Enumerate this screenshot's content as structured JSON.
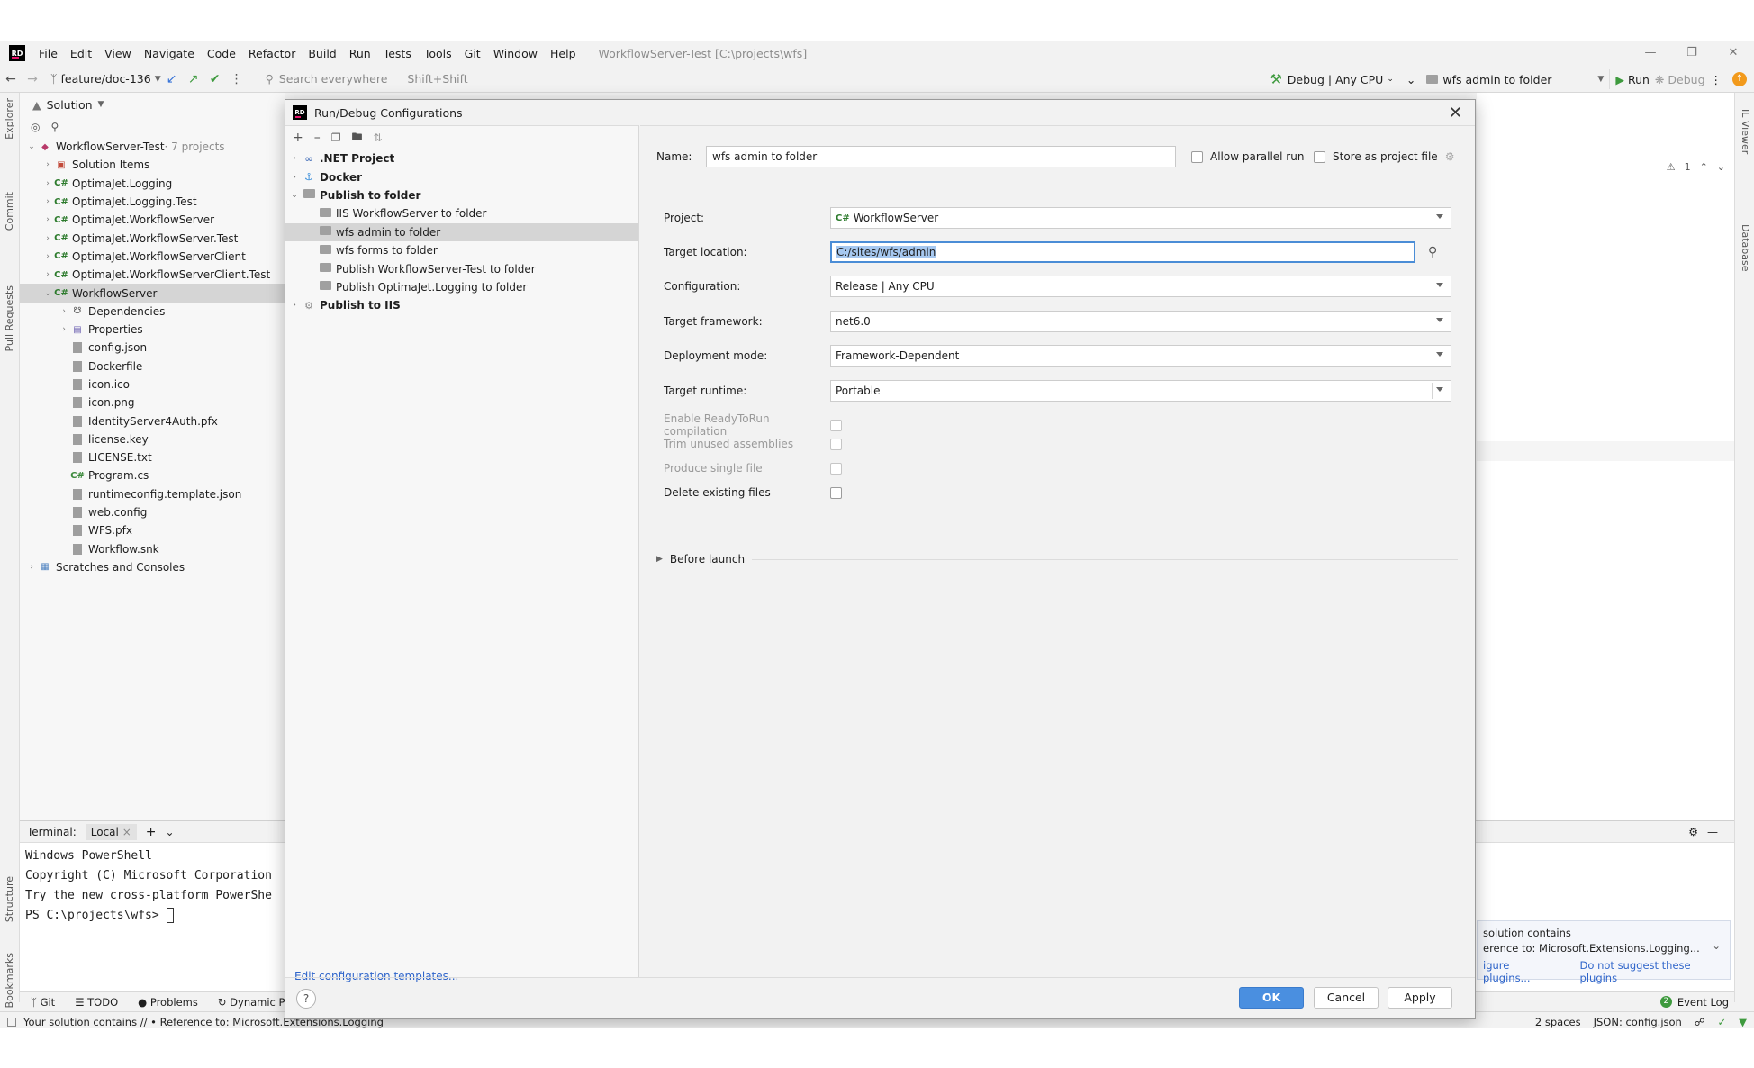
{
  "menubar": {
    "logo": "RD",
    "items": [
      "File",
      "Edit",
      "View",
      "Navigate",
      "Code",
      "Refactor",
      "Build",
      "Run",
      "Tests",
      "Tools",
      "Git",
      "Window",
      "Help"
    ],
    "window_title": "WorkflowServer-Test [C:\\projects\\wfs]"
  },
  "toolbar": {
    "branch": "feature/doc-136",
    "search_placeholder": "Search everywhere",
    "search_shortcut": "Shift+Shift",
    "build_config": "Debug | Any CPU",
    "run_config": "wfs admin to folder",
    "run_label": "Run",
    "debug_label": "Debug"
  },
  "left_stripe": {
    "explorer": "Explorer",
    "commit": "Commit",
    "pull_requests": "Pull Requests",
    "structure": "Structure",
    "bookmarks": "Bookmarks"
  },
  "right_stripe": {
    "il_viewer": "IL Viewer",
    "database": "Database"
  },
  "explorer": {
    "header": "Solution",
    "tree": [
      {
        "label": "WorkflowServer-Test",
        "sub": " · 7 projects",
        "level": 0,
        "arrow": "down",
        "icon": "solution-icon"
      },
      {
        "label": "Solution Items",
        "level": 1,
        "arrow": "right",
        "icon": "solution-items-icon"
      },
      {
        "label": "OptimaJet.Logging",
        "level": 1,
        "arrow": "right",
        "icon": "project-icon"
      },
      {
        "label": "OptimaJet.Logging.Test",
        "level": 1,
        "arrow": "right",
        "icon": "project-icon"
      },
      {
        "label": "OptimaJet.WorkflowServer",
        "level": 1,
        "arrow": "right",
        "icon": "project-icon"
      },
      {
        "label": "OptimaJet.WorkflowServer.Test",
        "level": 1,
        "arrow": "right",
        "icon": "project-icon"
      },
      {
        "label": "OptimaJet.WorkflowServerClient",
        "level": 1,
        "arrow": "right",
        "icon": "project-icon"
      },
      {
        "label": "OptimaJet.WorkflowServerClient.Test",
        "level": 1,
        "arrow": "right",
        "icon": "project-icon"
      },
      {
        "label": "WorkflowServer",
        "level": 1,
        "arrow": "down",
        "icon": "project-icon",
        "selected": true
      },
      {
        "label": "Dependencies",
        "level": 2,
        "arrow": "right",
        "icon": "dependencies-icon"
      },
      {
        "label": "Properties",
        "level": 2,
        "arrow": "right",
        "icon": "properties-icon"
      },
      {
        "label": "config.json",
        "level": 2,
        "icon": "file-icon"
      },
      {
        "label": "Dockerfile",
        "level": 2,
        "icon": "file-icon"
      },
      {
        "label": "icon.ico",
        "level": 2,
        "icon": "file-icon"
      },
      {
        "label": "icon.png",
        "level": 2,
        "icon": "file-icon"
      },
      {
        "label": "IdentityServer4Auth.pfx",
        "level": 2,
        "icon": "file-icon"
      },
      {
        "label": "license.key",
        "level": 2,
        "icon": "file-icon"
      },
      {
        "label": "LICENSE.txt",
        "level": 2,
        "icon": "file-icon"
      },
      {
        "label": "Program.cs",
        "level": 2,
        "icon": "csharp-file-icon"
      },
      {
        "label": "runtimeconfig.template.json",
        "level": 2,
        "icon": "file-icon"
      },
      {
        "label": "web.config",
        "level": 2,
        "icon": "file-icon"
      },
      {
        "label": "WFS.pfx",
        "level": 2,
        "icon": "file-icon"
      },
      {
        "label": "Workflow.snk",
        "level": 2,
        "icon": "file-icon"
      },
      {
        "label": "Scratches and Consoles",
        "level": 0,
        "arrow": "right",
        "icon": "scratches-icon"
      }
    ]
  },
  "editor": {
    "warnings": "1"
  },
  "terminal": {
    "label": "Terminal:",
    "tab": "Local",
    "lines": [
      "Windows PowerShell",
      "Copyright (C) Microsoft Corporation",
      "Try the new cross-platform PowerShe"
    ],
    "prompt": "PS C:\\projects\\wfs> "
  },
  "notification": {
    "line1": "solution contains",
    "line2": "erence to: Microsoft.Extensions.Logging...",
    "link1": "igure plugins...",
    "link2": "Do not suggest these plugins"
  },
  "bottom_tabs": [
    "Git",
    "TODO",
    "Problems",
    "Dynamic P"
  ],
  "event_log": "Event Log",
  "statusbar": {
    "message": "Your solution contains // • Reference to: Microsoft.Extensions.Logging",
    "indent": "2 spaces",
    "file_type": "JSON: config.json"
  },
  "dialog": {
    "title": "Run/Debug Configurations",
    "tree": [
      {
        "label": ".NET Project",
        "level": 0,
        "arrow": "right",
        "bold": true,
        "icon": "dotnet-icon"
      },
      {
        "label": "Docker",
        "level": 0,
        "arrow": "right",
        "bold": true,
        "icon": "docker-icon"
      },
      {
        "label": "Publish to folder",
        "level": 0,
        "arrow": "down",
        "bold": true,
        "icon": "folder-icon"
      },
      {
        "label": "IIS WorkflowServer to folder",
        "level": 1,
        "icon": "folder-icon"
      },
      {
        "label": "wfs admin to folder",
        "level": 1,
        "icon": "folder-icon",
        "selected": true
      },
      {
        "label": "wfs forms to folder",
        "level": 1,
        "icon": "folder-icon"
      },
      {
        "label": "Publish WorkflowServer-Test to folder",
        "level": 1,
        "icon": "folder-icon"
      },
      {
        "label": "Publish OptimaJet.Logging to folder",
        "level": 1,
        "icon": "folder-icon"
      },
      {
        "label": "Publish to IIS",
        "level": 0,
        "arrow": "right",
        "bold": true,
        "icon": "iis-icon"
      }
    ],
    "edit_templates": "Edit configuration templates...",
    "name_label": "Name:",
    "name_value": "wfs admin to folder",
    "allow_parallel": "Allow parallel run",
    "store_as_project": "Store as project file",
    "project_label": "Project:",
    "project_value": "WorkflowServer",
    "target_location_label": "Target location:",
    "target_location_value": "C:/sites/wfs/admin",
    "configuration_label": "Configuration:",
    "configuration_value": "Release | Any CPU",
    "framework_label": "Target framework:",
    "framework_value": "net6.0",
    "deployment_label": "Deployment mode:",
    "deployment_value": "Framework-Dependent",
    "runtime_label": "Target runtime:",
    "runtime_value": "Portable",
    "ready_to_run": "Enable ReadyToRun compilation",
    "trim": "Trim unused assemblies",
    "single_file": "Produce single file",
    "delete_existing": "Delete existing files",
    "before_launch": "Before launch",
    "ok": "OK",
    "cancel": "Cancel",
    "apply": "Apply",
    "help": "?"
  }
}
